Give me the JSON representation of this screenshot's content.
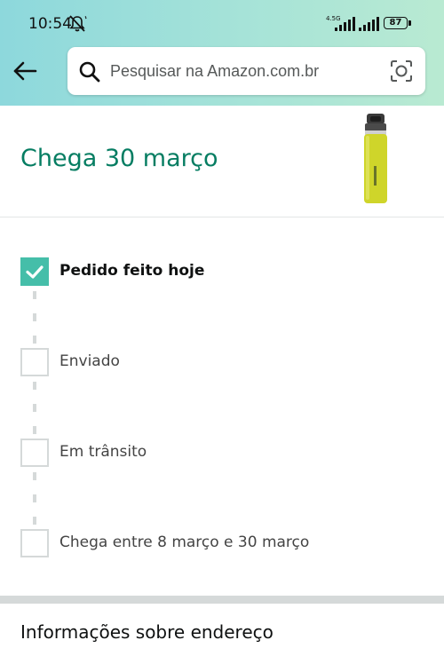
{
  "status_bar": {
    "time": "10:54",
    "network_label": "4.5G",
    "battery": "87"
  },
  "search": {
    "placeholder": "Pesquisar na Amazon.com.br"
  },
  "delivery": {
    "title": "Chega 30 março"
  },
  "tracking_steps": [
    {
      "label": "Pedido feito hoje",
      "checked": true
    },
    {
      "label": "Enviado",
      "checked": false
    },
    {
      "label": "Em trânsito",
      "checked": false
    },
    {
      "label": "Chega entre 8 março e 30 março",
      "checked": false
    }
  ],
  "address_section": {
    "heading": "Informações sobre endereço"
  },
  "colors": {
    "accent_teal": "#067d62",
    "check_green": "#45bea9",
    "header_gradient_start": "#8dd8dc",
    "header_gradient_end": "#b9ead2"
  },
  "icons": [
    "mute-icon",
    "signal-icon",
    "battery-icon",
    "back-arrow-icon",
    "search-icon",
    "camera-scan-icon",
    "checkmark-icon"
  ]
}
